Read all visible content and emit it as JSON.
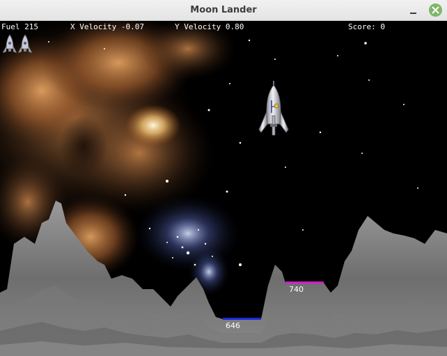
{
  "window": {
    "title": "Moon Lander"
  },
  "hud": {
    "fuel": "Fuel 215",
    "x_velocity": "X Velocity -0.07",
    "y_velocity": "Y Velocity 0.80",
    "score": "Score: 0"
  },
  "lives_remaining": 2,
  "landing_pads": [
    {
      "label": "646",
      "color": "#1a2ad8"
    },
    {
      "label": "740",
      "color": "#d21ad2"
    }
  ],
  "colors": {
    "close_button": "#7fb66a",
    "terrain": "#8a8a8a",
    "space": "#000000"
  },
  "icons": [
    "minimize-icon",
    "close-icon",
    "rocket-icon"
  ]
}
